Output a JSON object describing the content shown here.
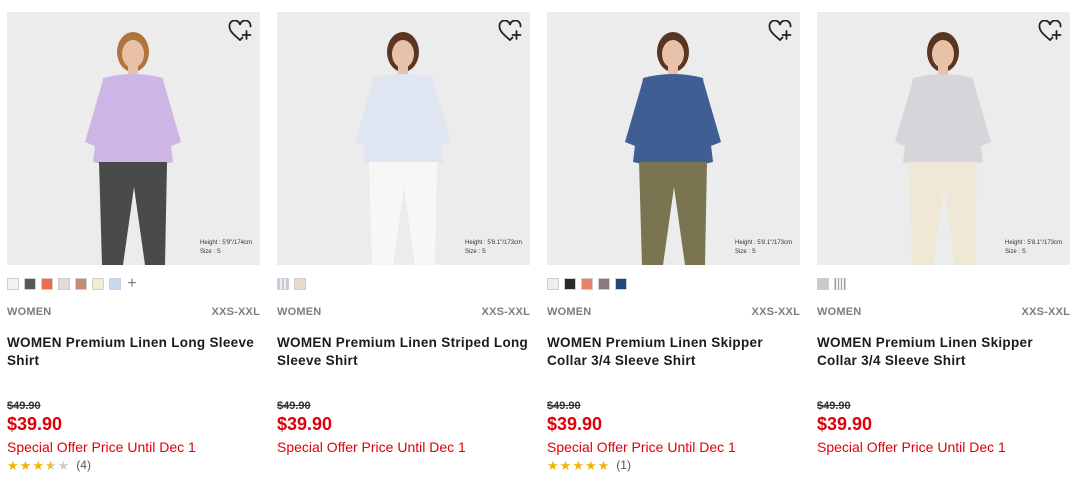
{
  "products": [
    {
      "category": "WOMEN",
      "sizes": "XXS-XXL",
      "title": "WOMEN Premium Linen Long Sleeve Shirt",
      "original_price": "$49.90",
      "price": "$39.90",
      "offer": "Special Offer Price Until Dec 1",
      "height_info": "Height : 5'9\"/174cm",
      "size_info": "Size : S",
      "rating": 3.5,
      "review_count": "(4)",
      "more_colors_icon": "plus-icon",
      "swatches": [
        "#f2f2f2",
        "#575757",
        "#f06a4e",
        "#e0dad4",
        "#c58a6f",
        "#eeeed0",
        "#c4d8f2"
      ],
      "garment_color": "#cdb6e6",
      "bottom_color": "#4a4a4a"
    },
    {
      "category": "WOMEN",
      "sizes": "XXS-XXL",
      "title": "WOMEN Premium Linen Striped Long Sleeve Shirt",
      "original_price": "$49.90",
      "price": "$39.90",
      "offer": "Special Offer Price Until Dec 1",
      "height_info": "Height : 5'8.1\"/173cm",
      "size_info": "Size : S",
      "swatches": [
        "lstripe",
        "#e6dccb"
      ],
      "garment_color": "#dfe6f1",
      "bottom_color": "#f7f7f7"
    },
    {
      "category": "WOMEN",
      "sizes": "XXS-XXL",
      "title": "WOMEN Premium Linen Skipper Collar 3/4 Sleeve Shirt",
      "original_price": "$49.90",
      "price": "$39.90",
      "offer": "Special Offer Price Until Dec 1",
      "height_info": "Height : 5'8.1\"/173cm",
      "size_info": "Size : S",
      "rating": 5,
      "review_count": "(1)",
      "swatches": [
        "#eeeeee",
        "#2a2a2a",
        "#ea8069",
        "#8a7c78",
        "#24487d"
      ],
      "garment_color": "#3f5f94",
      "bottom_color": "#7a7451"
    },
    {
      "category": "WOMEN",
      "sizes": "XXS-XXL",
      "title": "WOMEN Premium Linen Skipper Collar 3/4 Sleeve Shirt",
      "original_price": "$49.90",
      "price": "$39.90",
      "offer": "Special Offer Price Until Dec 1",
      "height_info": "Height : 5'8.1\"/173cm",
      "size_info": "Size : S",
      "swatches": [
        "#c9c9c9",
        "stripe"
      ],
      "garment_color": "#d6d6da",
      "bottom_color": "#efe8d6"
    }
  ],
  "icons": {
    "favorite": "heart-plus-icon",
    "star": "star-icon"
  },
  "colors": {
    "sale_red": "#e0000a",
    "star_yellow": "#f2b400"
  }
}
